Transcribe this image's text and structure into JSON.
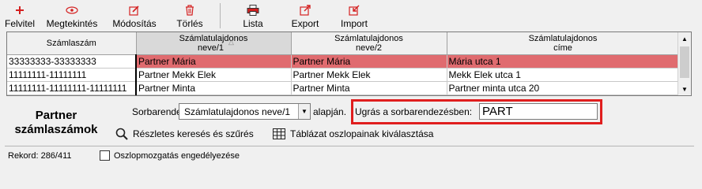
{
  "toolbar": {
    "buttons": [
      {
        "label": "Felvitel",
        "icon": "plus-icon"
      },
      {
        "label": "Megtekintés",
        "icon": "eye-icon"
      },
      {
        "label": "Módosítás",
        "icon": "edit-icon"
      },
      {
        "label": "Törlés",
        "icon": "trash-icon"
      },
      {
        "label": "Lista",
        "icon": "printer-icon"
      },
      {
        "label": "Export",
        "icon": "export-icon"
      },
      {
        "label": "Import",
        "icon": "import-icon"
      }
    ]
  },
  "grid": {
    "columns": [
      {
        "line1": "Számlaszám",
        "line2": ""
      },
      {
        "line1": "Számlatulajdonos",
        "line2": "neve/1"
      },
      {
        "line1": "Számlatulajdonos",
        "line2": "neve/2"
      },
      {
        "line1": "Számlatulajdonos",
        "line2": "címe"
      }
    ],
    "sort_indicator": "△",
    "rows": [
      [
        "33333333-33333333",
        "Partner Mária",
        "Partner Mária",
        "Mária utca 1"
      ],
      [
        "11111111-11111111",
        "Partner Mekk Elek",
        "Partner Mekk Elek",
        "Mekk Elek utca 1"
      ],
      [
        "11111111-11111111-11111111",
        "Partner Minta",
        "Partner Minta",
        "Partner minta utca 20"
      ]
    ]
  },
  "panel": {
    "title_line1": "Partner",
    "title_line2": "számlaszámok",
    "sort_label": "Sorbarendezve",
    "sort_value": "Számlatulajdonos neve/1",
    "alapjan": "alapján.",
    "jump_label": "Ugrás a sorbarendezésben:",
    "jump_value": "PART",
    "search_link": "Részletes keresés és szűrés",
    "columns_link": "Táblázat oszlopainak kiválasztása"
  },
  "status": {
    "record_text": "Rekord:  286/411",
    "checkbox_label": "Oszlopmozgatás engedélyezése",
    "checkbox_checked": false
  },
  "colors": {
    "selected_row": "#e06b6f",
    "highlight_border": "#e01e1e",
    "icon_red": "#d42020"
  }
}
